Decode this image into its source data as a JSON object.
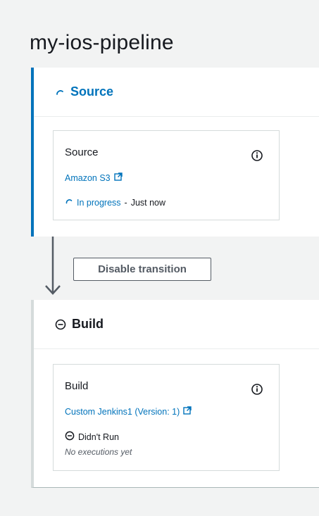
{
  "pipeline": {
    "title": "my-ios-pipeline"
  },
  "stages": {
    "source": {
      "name": "Source",
      "action": {
        "name": "Source",
        "provider": "Amazon S3",
        "status": "In progress",
        "separator": "-",
        "time": "Just now"
      }
    },
    "transition": {
      "button_label": "Disable transition"
    },
    "build": {
      "name": "Build",
      "action": {
        "name": "Build",
        "provider": "Custom Jenkins1 (Version: 1)",
        "status": "Didn't Run",
        "note": "No executions yet"
      }
    }
  },
  "colors": {
    "accent": "#0073bb",
    "text": "#16191f",
    "muted": "#545b64",
    "border": "#d5dbdb",
    "background": "#f2f3f3"
  }
}
